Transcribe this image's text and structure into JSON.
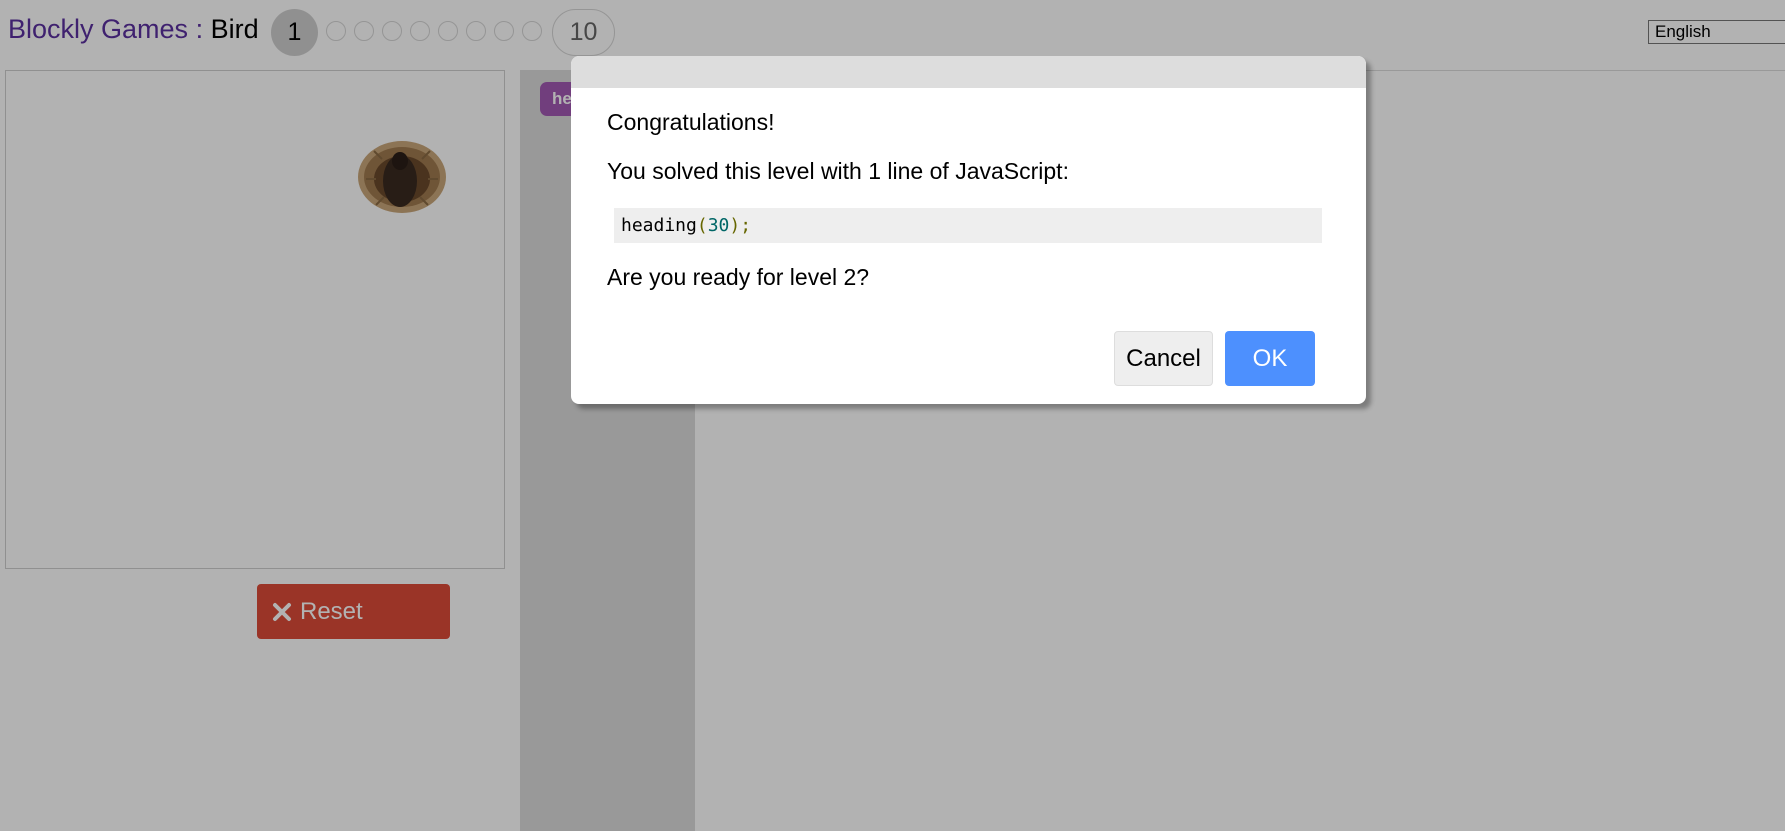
{
  "header": {
    "games_link": "Blockly Games",
    "separator": " : ",
    "game_name": "Bird",
    "levels": {
      "current": "1",
      "last": "10",
      "dots_count": 8
    },
    "language": "English"
  },
  "visualization": {
    "reset_label": "Reset",
    "icons": [
      "nest-icon",
      "close-icon"
    ]
  },
  "workspace": {
    "toolbox_block_label": "heading"
  },
  "dialog": {
    "congrats": "Congratulations!",
    "solved_text": "You solved this level with 1 line of JavaScript:",
    "code": {
      "fn": "heading",
      "open": "(",
      "arg": "30",
      "close": ");"
    },
    "ready_text": "Are you ready for level 2?",
    "cancel_label": "Cancel",
    "ok_label": "OK"
  },
  "colors": {
    "reset_button": "#dd4b39",
    "ok_button": "#4d90fe",
    "toolbox_block": "#a35ab3",
    "title_link": "#5b30a0"
  }
}
